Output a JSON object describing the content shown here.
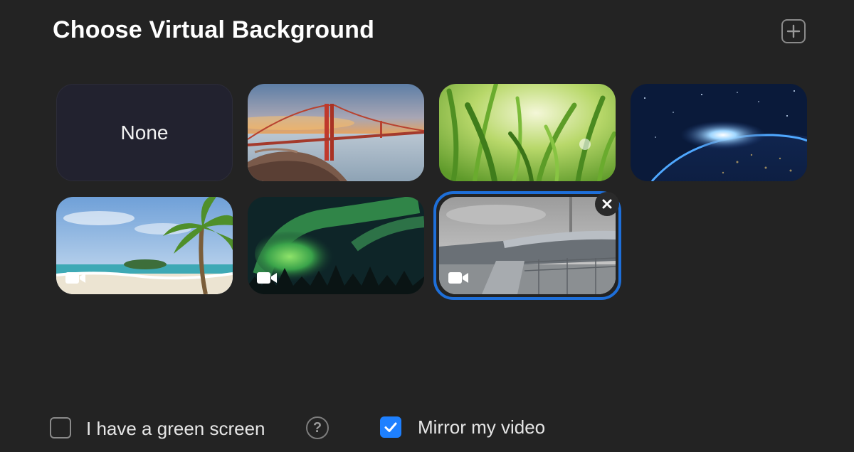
{
  "title": "Choose Virtual Background",
  "icons": {
    "add": "plus-square-icon",
    "remove": "close-icon",
    "video": "video-camera-icon",
    "help": "question-circle-icon",
    "check": "checkmark-icon"
  },
  "backgrounds": [
    {
      "label": "None",
      "kind": "none",
      "selected": false
    },
    {
      "scene": "golden-gate-bridge",
      "selected": false
    },
    {
      "scene": "grass",
      "selected": false
    },
    {
      "scene": "earth-from-space",
      "selected": false
    },
    {
      "scene": "beach-palm",
      "video": true,
      "selected": false
    },
    {
      "scene": "aurora",
      "video": true,
      "selected": false
    },
    {
      "scene": "stadium",
      "video": true,
      "selected": true
    }
  ],
  "options": {
    "green_screen": {
      "label": "I have a green screen",
      "checked": false,
      "help": "?"
    },
    "mirror": {
      "label": "Mirror my video",
      "checked": true
    }
  },
  "colors": {
    "background": "#232323",
    "accent": "#1e80ff",
    "selection": "#1e6fd9"
  }
}
